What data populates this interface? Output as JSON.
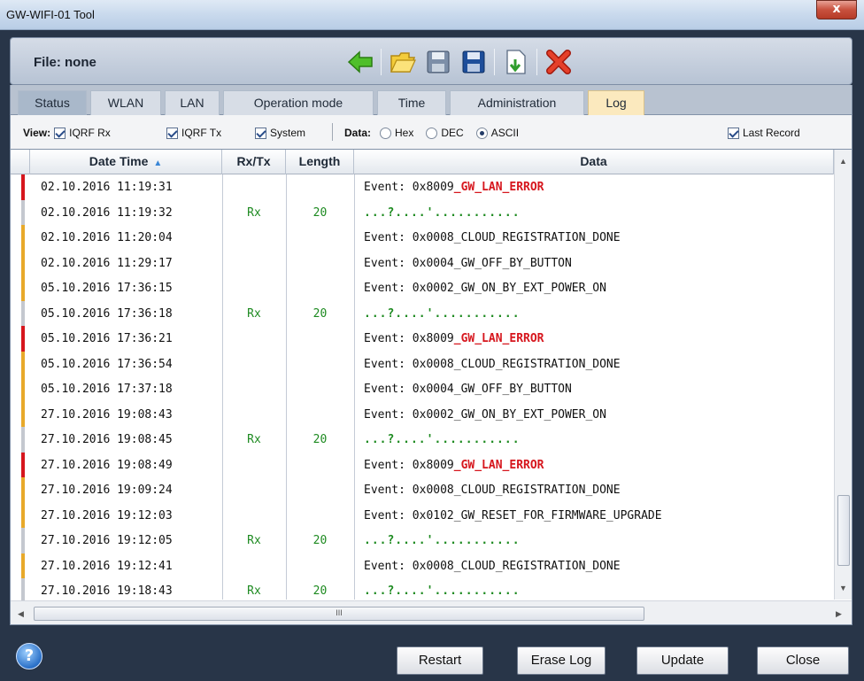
{
  "window": {
    "title": "GW-WIFI-01 Tool",
    "close_glyph": "x"
  },
  "toolbar": {
    "file_prefix": "File:",
    "file_value": "none",
    "icons": [
      "back-arrow-icon",
      "open-folder-icon",
      "save-icon",
      "save-as-icon",
      "export-icon",
      "delete-icon"
    ]
  },
  "tabs": [
    {
      "label": "Status"
    },
    {
      "label": "WLAN"
    },
    {
      "label": "LAN"
    },
    {
      "label": "Operation mode"
    },
    {
      "label": "Time"
    },
    {
      "label": "Administration"
    },
    {
      "label": "Log"
    }
  ],
  "viewbar": {
    "view_label": "View:",
    "iqrf_rx": {
      "label": "IQRF Rx",
      "checked": true
    },
    "iqrf_tx": {
      "label": "IQRF Tx",
      "checked": true
    },
    "system": {
      "label": "System",
      "checked": true
    },
    "data_label": "Data:",
    "hex": {
      "label": "Hex",
      "selected": false
    },
    "dec": {
      "label": "DEC",
      "selected": false
    },
    "ascii": {
      "label": "ASCII",
      "selected": true
    },
    "last_record": {
      "label": "Last Record",
      "checked": true
    }
  },
  "grid": {
    "columns": [
      "Date Time",
      "Rx/Tx",
      "Length",
      "Data"
    ],
    "scroll_grip": "III",
    "rows": [
      {
        "datetime": "02.10.2016 11:19:31",
        "rxtx": "",
        "length": "",
        "prefix": "Event: 0x8009",
        "error": "_GW_LAN_ERROR",
        "type": "error"
      },
      {
        "datetime": "02.10.2016 11:19:32",
        "rxtx": "Rx",
        "length": "20",
        "prefix": "...?....'...........",
        "error": "",
        "type": "rx"
      },
      {
        "datetime": "02.10.2016 11:20:04",
        "rxtx": "",
        "length": "",
        "prefix": "Event: 0x0008_CLOUD_REGISTRATION_DONE",
        "error": "",
        "type": "event"
      },
      {
        "datetime": "02.10.2016 11:29:17",
        "rxtx": "",
        "length": "",
        "prefix": "Event: 0x0004_GW_OFF_BY_BUTTON",
        "error": "",
        "type": "event"
      },
      {
        "datetime": "05.10.2016 17:36:15",
        "rxtx": "",
        "length": "",
        "prefix": "Event: 0x0002_GW_ON_BY_EXT_POWER_ON",
        "error": "",
        "type": "event"
      },
      {
        "datetime": "05.10.2016 17:36:18",
        "rxtx": "Rx",
        "length": "20",
        "prefix": "...?....'...........",
        "error": "",
        "type": "rx"
      },
      {
        "datetime": "05.10.2016 17:36:21",
        "rxtx": "",
        "length": "",
        "prefix": "Event: 0x8009",
        "error": "_GW_LAN_ERROR",
        "type": "error"
      },
      {
        "datetime": "05.10.2016 17:36:54",
        "rxtx": "",
        "length": "",
        "prefix": "Event: 0x0008_CLOUD_REGISTRATION_DONE",
        "error": "",
        "type": "event"
      },
      {
        "datetime": "05.10.2016 17:37:18",
        "rxtx": "",
        "length": "",
        "prefix": "Event: 0x0004_GW_OFF_BY_BUTTON",
        "error": "",
        "type": "event"
      },
      {
        "datetime": "27.10.2016 19:08:43",
        "rxtx": "",
        "length": "",
        "prefix": "Event: 0x0002_GW_ON_BY_EXT_POWER_ON",
        "error": "",
        "type": "event"
      },
      {
        "datetime": "27.10.2016 19:08:45",
        "rxtx": "Rx",
        "length": "20",
        "prefix": "...?....'...........",
        "error": "",
        "type": "rx"
      },
      {
        "datetime": "27.10.2016 19:08:49",
        "rxtx": "",
        "length": "",
        "prefix": "Event: 0x8009",
        "error": "_GW_LAN_ERROR",
        "type": "error"
      },
      {
        "datetime": "27.10.2016 19:09:24",
        "rxtx": "",
        "length": "",
        "prefix": "Event: 0x0008_CLOUD_REGISTRATION_DONE",
        "error": "",
        "type": "event"
      },
      {
        "datetime": "27.10.2016 19:12:03",
        "rxtx": "",
        "length": "",
        "prefix": "Event: 0x0102_GW_RESET_FOR_FIRMWARE_UPGRADE",
        "error": "",
        "type": "event"
      },
      {
        "datetime": "27.10.2016 19:12:05",
        "rxtx": "Rx",
        "length": "20",
        "prefix": "...?....'...........",
        "error": "",
        "type": "rx"
      },
      {
        "datetime": "27.10.2016 19:12:41",
        "rxtx": "",
        "length": "",
        "prefix": "Event: 0x0008_CLOUD_REGISTRATION_DONE",
        "error": "",
        "type": "event"
      },
      {
        "datetime": "27.10.2016 19:18:43",
        "rxtx": "Rx",
        "length": "20",
        "prefix": "...?....'...........",
        "error": "",
        "type": "rx"
      }
    ]
  },
  "colors": {
    "error": "#d6161d",
    "event": "#e8a92a",
    "rx": "#c4c8cf",
    "rx_text": "#1d8a20",
    "active_tab": "#fbe9be"
  },
  "buttons": {
    "help": "?",
    "restart": "Restart",
    "erase_log": "Erase Log",
    "update": "Update",
    "close": "Close"
  }
}
